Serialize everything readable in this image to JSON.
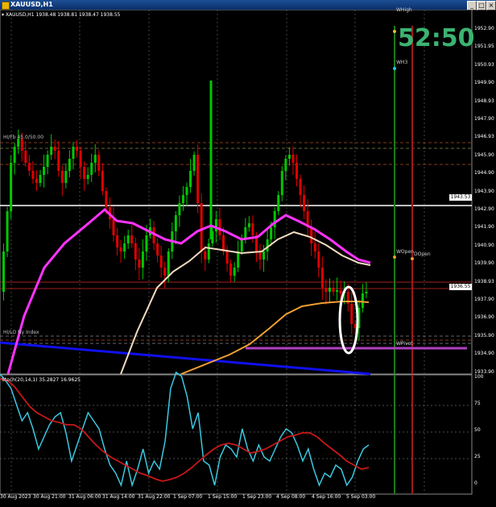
{
  "window": {
    "title": "XAUUSD,H1",
    "buttons": [
      "_",
      "□",
      "×"
    ]
  },
  "chart_header": "XAUUSD,H1  1938.48 1938.81 1938.47 1938.55",
  "countdown": "52:50",
  "current_price_tag": "1936.55",
  "marker_price_tag": "1943.53",
  "price_axis": [
    "1952.90",
    "1951.95",
    "1950.93",
    "1949.90",
    "1948.93",
    "1947.90",
    "1946.93",
    "1945.90",
    "1944.90",
    "1943.90",
    "1942.90",
    "1941.90",
    "1940.90",
    "1939.90",
    "1938.93",
    "1937.90",
    "1936.90",
    "1935.90",
    "1934.90",
    "1933.90"
  ],
  "stoch_header": "Stoch(20,14,1) 35.2827 16.9625",
  "stoch_axis": [
    "100",
    "75",
    "50",
    "25",
    "0"
  ],
  "time_axis": [
    "30 Aug 2023",
    "30 Aug 21:00",
    "31 Aug 06:00",
    "31 Aug 14:00",
    "31 Aug 22:00",
    "1 Sep 07:00",
    "1 Sep 15:00",
    "1 Sep 23:00",
    "4 Sep 08:00",
    "4 Sep 16:00",
    "5 Sep 03:00"
  ],
  "annotations": {
    "whigh": "WHigh",
    "wh3": "WH3",
    "wopen": "WOpen",
    "dopen": "DOpen",
    "wpivot": "WPivot",
    "left_top": "HI/Fb 45.0/50.00",
    "left_mid": "HI/LO Ny Index"
  },
  "colors": {
    "bull": "#00c800",
    "bear": "#e00000",
    "ma_magenta": "#ff33ff",
    "ma_white": "#f2dcc0",
    "ma_orange": "#f0a030",
    "blue_line": "#0000ee",
    "stoch_main": "#3bc8e0",
    "stoch_signal": "#c81818",
    "grid": "#5a5a5a"
  }
}
